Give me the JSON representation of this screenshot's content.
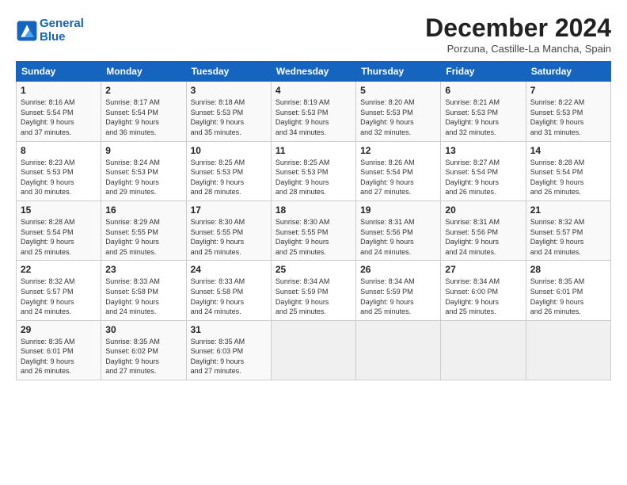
{
  "header": {
    "logo_line1": "General",
    "logo_line2": "Blue",
    "title": "December 2024",
    "subtitle": "Porzuna, Castille-La Mancha, Spain"
  },
  "weekdays": [
    "Sunday",
    "Monday",
    "Tuesday",
    "Wednesday",
    "Thursday",
    "Friday",
    "Saturday"
  ],
  "weeks": [
    [
      {
        "day": "1",
        "info": "Sunrise: 8:16 AM\nSunset: 5:54 PM\nDaylight: 9 hours\nand 37 minutes."
      },
      {
        "day": "2",
        "info": "Sunrise: 8:17 AM\nSunset: 5:54 PM\nDaylight: 9 hours\nand 36 minutes."
      },
      {
        "day": "3",
        "info": "Sunrise: 8:18 AM\nSunset: 5:53 PM\nDaylight: 9 hours\nand 35 minutes."
      },
      {
        "day": "4",
        "info": "Sunrise: 8:19 AM\nSunset: 5:53 PM\nDaylight: 9 hours\nand 34 minutes."
      },
      {
        "day": "5",
        "info": "Sunrise: 8:20 AM\nSunset: 5:53 PM\nDaylight: 9 hours\nand 32 minutes."
      },
      {
        "day": "6",
        "info": "Sunrise: 8:21 AM\nSunset: 5:53 PM\nDaylight: 9 hours\nand 32 minutes."
      },
      {
        "day": "7",
        "info": "Sunrise: 8:22 AM\nSunset: 5:53 PM\nDaylight: 9 hours\nand 31 minutes."
      }
    ],
    [
      {
        "day": "8",
        "info": "Sunrise: 8:23 AM\nSunset: 5:53 PM\nDaylight: 9 hours\nand 30 minutes."
      },
      {
        "day": "9",
        "info": "Sunrise: 8:24 AM\nSunset: 5:53 PM\nDaylight: 9 hours\nand 29 minutes."
      },
      {
        "day": "10",
        "info": "Sunrise: 8:25 AM\nSunset: 5:53 PM\nDaylight: 9 hours\nand 28 minutes."
      },
      {
        "day": "11",
        "info": "Sunrise: 8:25 AM\nSunset: 5:53 PM\nDaylight: 9 hours\nand 28 minutes."
      },
      {
        "day": "12",
        "info": "Sunrise: 8:26 AM\nSunset: 5:54 PM\nDaylight: 9 hours\nand 27 minutes."
      },
      {
        "day": "13",
        "info": "Sunrise: 8:27 AM\nSunset: 5:54 PM\nDaylight: 9 hours\nand 26 minutes."
      },
      {
        "day": "14",
        "info": "Sunrise: 8:28 AM\nSunset: 5:54 PM\nDaylight: 9 hours\nand 26 minutes."
      }
    ],
    [
      {
        "day": "15",
        "info": "Sunrise: 8:28 AM\nSunset: 5:54 PM\nDaylight: 9 hours\nand 25 minutes."
      },
      {
        "day": "16",
        "info": "Sunrise: 8:29 AM\nSunset: 5:55 PM\nDaylight: 9 hours\nand 25 minutes."
      },
      {
        "day": "17",
        "info": "Sunrise: 8:30 AM\nSunset: 5:55 PM\nDaylight: 9 hours\nand 25 minutes."
      },
      {
        "day": "18",
        "info": "Sunrise: 8:30 AM\nSunset: 5:55 PM\nDaylight: 9 hours\nand 25 minutes."
      },
      {
        "day": "19",
        "info": "Sunrise: 8:31 AM\nSunset: 5:56 PM\nDaylight: 9 hours\nand 24 minutes."
      },
      {
        "day": "20",
        "info": "Sunrise: 8:31 AM\nSunset: 5:56 PM\nDaylight: 9 hours\nand 24 minutes."
      },
      {
        "day": "21",
        "info": "Sunrise: 8:32 AM\nSunset: 5:57 PM\nDaylight: 9 hours\nand 24 minutes."
      }
    ],
    [
      {
        "day": "22",
        "info": "Sunrise: 8:32 AM\nSunset: 5:57 PM\nDaylight: 9 hours\nand 24 minutes."
      },
      {
        "day": "23",
        "info": "Sunrise: 8:33 AM\nSunset: 5:58 PM\nDaylight: 9 hours\nand 24 minutes."
      },
      {
        "day": "24",
        "info": "Sunrise: 8:33 AM\nSunset: 5:58 PM\nDaylight: 9 hours\nand 24 minutes."
      },
      {
        "day": "25",
        "info": "Sunrise: 8:34 AM\nSunset: 5:59 PM\nDaylight: 9 hours\nand 25 minutes."
      },
      {
        "day": "26",
        "info": "Sunrise: 8:34 AM\nSunset: 5:59 PM\nDaylight: 9 hours\nand 25 minutes."
      },
      {
        "day": "27",
        "info": "Sunrise: 8:34 AM\nSunset: 6:00 PM\nDaylight: 9 hours\nand 25 minutes."
      },
      {
        "day": "28",
        "info": "Sunrise: 8:35 AM\nSunset: 6:01 PM\nDaylight: 9 hours\nand 26 minutes."
      }
    ],
    [
      {
        "day": "29",
        "info": "Sunrise: 8:35 AM\nSunset: 6:01 PM\nDaylight: 9 hours\nand 26 minutes."
      },
      {
        "day": "30",
        "info": "Sunrise: 8:35 AM\nSunset: 6:02 PM\nDaylight: 9 hours\nand 27 minutes."
      },
      {
        "day": "31",
        "info": "Sunrise: 8:35 AM\nSunset: 6:03 PM\nDaylight: 9 hours\nand 27 minutes."
      },
      {
        "day": "",
        "info": ""
      },
      {
        "day": "",
        "info": ""
      },
      {
        "day": "",
        "info": ""
      },
      {
        "day": "",
        "info": ""
      }
    ]
  ]
}
